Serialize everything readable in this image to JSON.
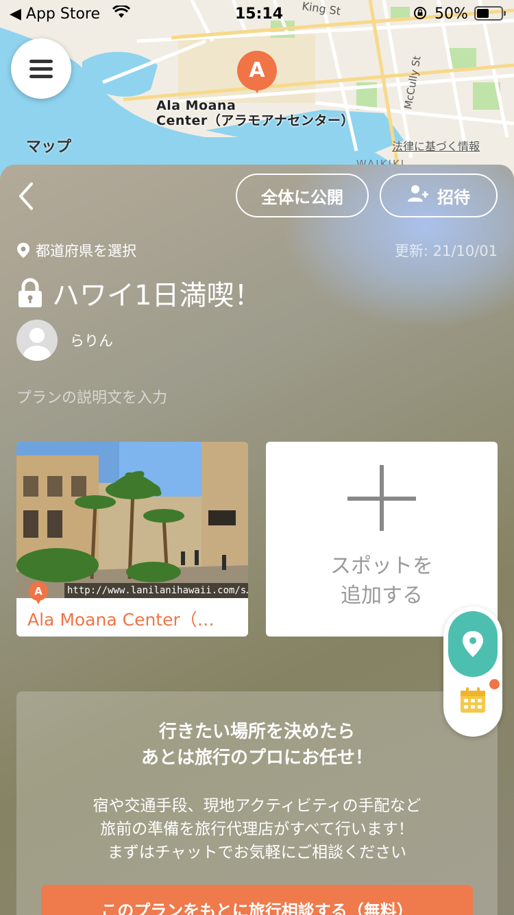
{
  "status_bar": {
    "back_app": "◀ App Store",
    "time": "15:14",
    "battery": "50%"
  },
  "map": {
    "place_label_line1": "Ala Moana",
    "place_label_line2": "Center（アラモアナセンター）",
    "pin_letter": "A",
    "apple_maps_label": "マップ",
    "legal_link": "法律に基づく情報",
    "streets": [
      "King St",
      "McCully St",
      "WAIKIKI"
    ]
  },
  "header": {
    "publish_button": "全体に公開",
    "invite_button": "招待"
  },
  "plan": {
    "prefecture_select": "都道府県を選択",
    "updated": "更新: 21/10/01",
    "title": "ハワイ1日満喫！",
    "user_name": "らりん",
    "description_placeholder": "プランの説明文を入力"
  },
  "spots": [
    {
      "letter": "A",
      "url": "http://www.lanilanihawaii.com/s…",
      "name": "Ala Moana Center（…"
    }
  ],
  "add_spot": {
    "line1": "スポットを",
    "line2": "追加する"
  },
  "promo": {
    "title_line1": "行きたい場所を決めたら",
    "title_line2": "あとは旅行のプロにお任せ！",
    "body_line1": "宿や交通手段、現地アクティビティの手配など",
    "body_line2": "旅前の準備を旅行代理店がすべて行います！",
    "body_line3": "まずはチャットでお気軽にご相談ください",
    "button": "このプランをもとに旅行相談する（無料）"
  },
  "colors": {
    "accent": "#f07446",
    "teal": "#4dbfb0"
  }
}
